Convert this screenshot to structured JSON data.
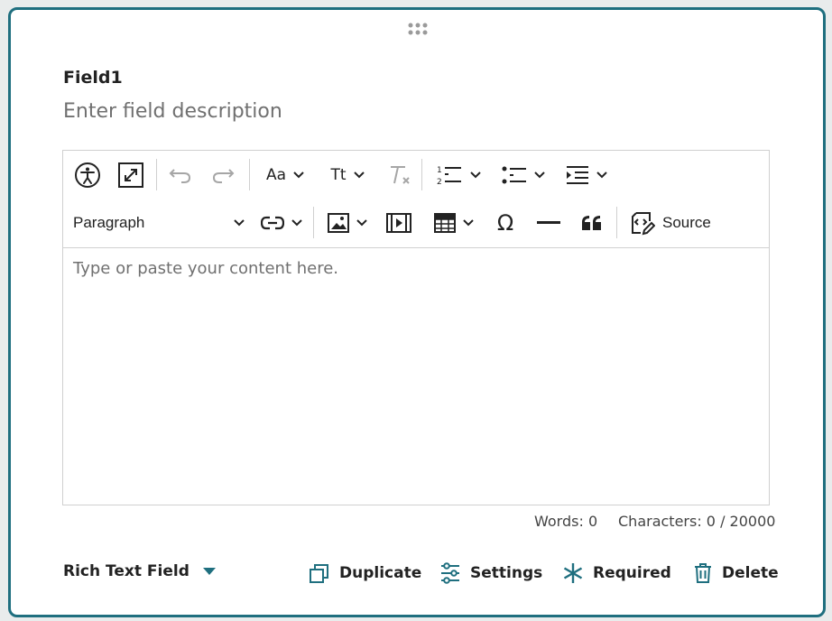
{
  "field": {
    "title": "Field1",
    "description_placeholder": "Enter field description"
  },
  "toolbar": {
    "paragraph_label": "Paragraph",
    "source_label": "Source",
    "font_size_label": "Aa",
    "text_transform_label": "Tt"
  },
  "editor": {
    "placeholder": "Type or paste your content here."
  },
  "stats": {
    "words": "Words: 0",
    "characters": "Characters: 0 / 20000"
  },
  "footer": {
    "field_type": "Rich Text Field",
    "duplicate": "Duplicate",
    "settings": "Settings",
    "required": "Required",
    "delete": "Delete"
  },
  "colors": {
    "accent": "#1f6f7f",
    "border": "#d0d0d0"
  }
}
